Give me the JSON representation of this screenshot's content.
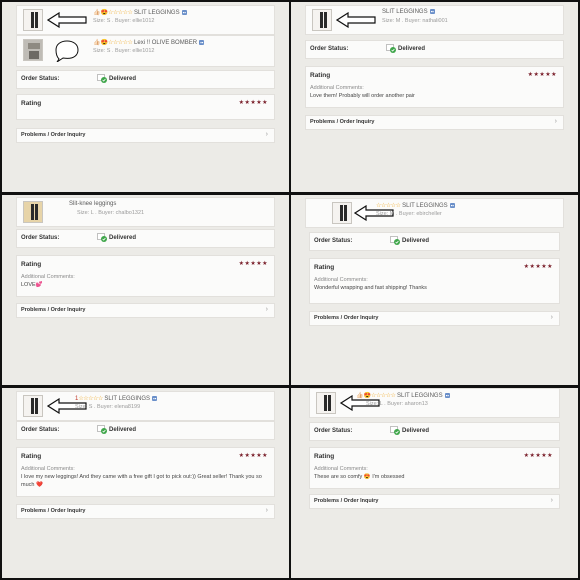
{
  "labels": {
    "order_status": "Order Status:",
    "delivered": "Delivered",
    "rating": "Rating",
    "additional_comments": "Additional Comments:",
    "problems": "Problems / Order Inquiry",
    "rating_stars": "★★★★★",
    "chevron": "›"
  },
  "panels": [
    {
      "items": [
        {
          "prefix": "👍🏻😍",
          "stars": "☆☆☆☆☆",
          "title": "SLIT LEGGINGS",
          "tag": "▪▪",
          "meta": "Size: S . Buyer: ellie1012"
        },
        {
          "prefix": "👍🏻😍",
          "stars": "☆☆☆☆☆",
          "title": "Lexi !! OLIVE BOMBER",
          "tag": "▪▪",
          "meta": "Size: S . Buyer: ellie1012"
        }
      ],
      "comment_label": "",
      "comment": ""
    },
    {
      "items": [
        {
          "prefix": "",
          "stars": "",
          "title": "SLIT LEGGINGS",
          "tag": "▪▪",
          "meta": "Size: M . Buyer: nathali001"
        }
      ],
      "comment_label": "Additional Comments:",
      "comment": "Love them! Probably will order another pair"
    },
    {
      "items": [
        {
          "prefix": "",
          "stars": "",
          "title": "Slit-knee leggings",
          "tag": "",
          "meta": "Size: L . Buyer: chalbo1321"
        }
      ],
      "comment_label": "Additional Comments:",
      "comment": "LOVE💕"
    },
    {
      "items": [
        {
          "prefix": "",
          "stars": "☆☆☆☆☆",
          "title": "SLIT LEGGINGS",
          "tag": "▪▪",
          "meta": "Size: M . Buyer: ebircheller"
        }
      ],
      "comment_label": "Additional Comments:",
      "comment": "Wonderful wrapping and fast shipping! Thanks"
    },
    {
      "items": [
        {
          "prefix": "1",
          "stars": "☆☆☆☆☆",
          "title": "SLIT LEGGINGS",
          "tag": "▪▪",
          "meta": "Size: S . Buyer: elena8199"
        }
      ],
      "comment_label": "Additional Comments:",
      "comment": "I love my new leggings! And they came with a free gift I got to pick out:)) Great seller! Thank you so much ❤️"
    },
    {
      "items": [
        {
          "prefix": "👍🏻😍",
          "stars": "☆☆☆☆☆",
          "title": "SLIT LEGGINGS",
          "tag": "▪▪",
          "meta": "Size: L . Buyer: aharon13"
        }
      ],
      "comment_label": "Additional Comments:",
      "comment": "These are so comfy 😍 I'm obsessed"
    }
  ]
}
